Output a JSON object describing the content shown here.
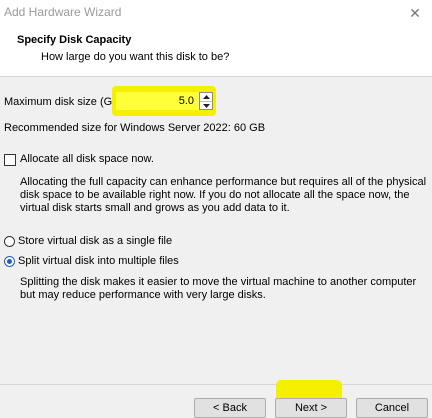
{
  "window": {
    "title": "Add Hardware Wizard",
    "close_icon": "close-icon"
  },
  "header": {
    "title": "Specify Disk Capacity",
    "subtitle": "How large do you want this disk to be?"
  },
  "disk": {
    "size_label": "Maximum disk size (GB):",
    "size_value": "5.0",
    "recommended": "Recommended size for Windows Server 2022: 60 GB",
    "allocate_label": "Allocate all disk space now.",
    "allocate_checked": false,
    "allocate_desc": [
      "Allocating the full capacity can enhance performance but requires all of the physical",
      "disk space to be available right now. If you do not allocate all the space now, the",
      "virtual disk starts small and grows as you add data to it."
    ]
  },
  "storage": {
    "single_label": "Store virtual disk as a single file",
    "split_label": "Split virtual disk into multiple files",
    "selected": "split",
    "split_desc": [
      "Splitting the disk makes it easier to move the virtual machine to another computer",
      "but may reduce performance with very large disks."
    ]
  },
  "buttons": {
    "back": "< Back",
    "next": "Next >",
    "cancel": "Cancel"
  },
  "colors": {
    "highlight": "#f4f000",
    "radio_selected": "#1f5fbf"
  }
}
